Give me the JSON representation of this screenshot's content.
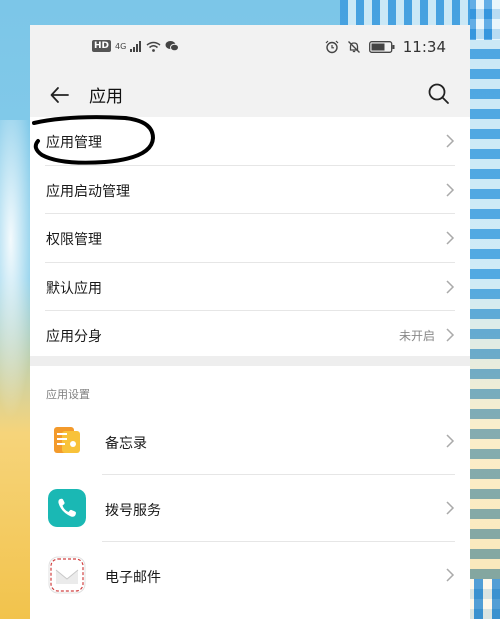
{
  "status_bar": {
    "hd": "HD",
    "network": "4G",
    "time": "11:34"
  },
  "app_bar": {
    "title": "应用"
  },
  "menu": [
    {
      "label": "应用管理",
      "value": ""
    },
    {
      "label": "应用启动管理",
      "value": ""
    },
    {
      "label": "权限管理",
      "value": ""
    },
    {
      "label": "默认应用",
      "value": ""
    },
    {
      "label": "应用分身",
      "value": "未开启"
    }
  ],
  "section": {
    "title": "应用设置"
  },
  "apps": [
    {
      "name": "备忘录",
      "icon": "notepad-icon"
    },
    {
      "name": "拨号服务",
      "icon": "phone-icon"
    },
    {
      "name": "电子邮件",
      "icon": "mail-icon"
    }
  ],
  "colors": {
    "annotation": "#000000",
    "phone_app": "#1ab8b4",
    "notepad_app": "#f39a2b"
  }
}
